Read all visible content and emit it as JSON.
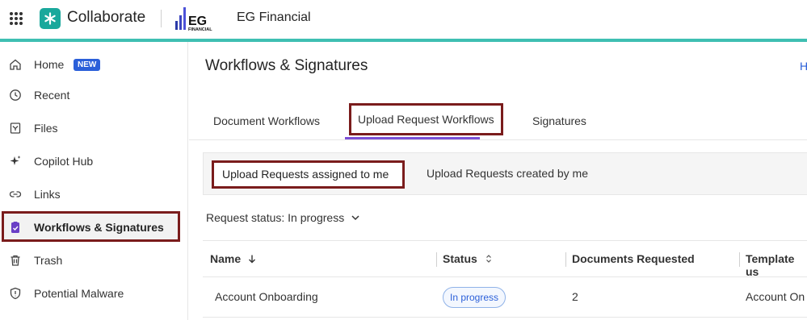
{
  "topbar": {
    "app_name": "Collaborate",
    "org_logo_text": "EG",
    "org_logo_subtext": "FINANCIAL",
    "org_name": "EG Financial",
    "accent_color": "#3fbfb2"
  },
  "sidebar": {
    "items": [
      {
        "label": "Home",
        "icon": "home-icon",
        "badge": "NEW"
      },
      {
        "label": "Recent",
        "icon": "clock-icon"
      },
      {
        "label": "Files",
        "icon": "files-icon"
      },
      {
        "label": "Copilot Hub",
        "icon": "sparkle-icon"
      },
      {
        "label": "Links",
        "icon": "link-icon"
      },
      {
        "label": "Workflows & Signatures",
        "icon": "clipboard-check-icon",
        "active": true
      },
      {
        "label": "Trash",
        "icon": "trash-icon"
      },
      {
        "label": "Potential Malware",
        "icon": "shield-alert-icon"
      }
    ]
  },
  "main": {
    "title": "Workflows & Signatures",
    "help_link": "H",
    "tabs": [
      {
        "label": "Document Workflows"
      },
      {
        "label": "Upload Request Workflows",
        "active": true
      },
      {
        "label": "Signatures"
      }
    ],
    "subtabs": [
      {
        "label": "Upload Requests assigned to me",
        "active": true
      },
      {
        "label": "Upload Requests created by me"
      }
    ],
    "filter": {
      "label": "Request status: In progress"
    },
    "table": {
      "columns": [
        "Name",
        "Status",
        "Documents Requested",
        "Template us"
      ],
      "rows": [
        {
          "name": "Account Onboarding",
          "status": "In progress",
          "documents": "2",
          "template": "Account On"
        }
      ]
    }
  },
  "colors": {
    "highlight_border": "#7a1c1c",
    "tab_underline": "#7b4fd6",
    "badge_bg": "#2b5fd9",
    "brand_teal": "#1aa89c"
  }
}
